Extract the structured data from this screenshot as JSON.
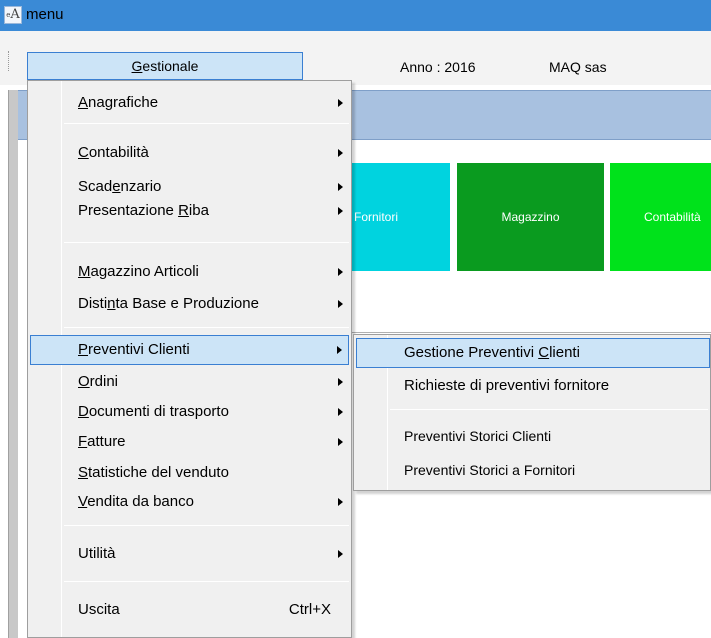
{
  "window": {
    "title": "menu",
    "icon": "app-icon"
  },
  "menubar": {
    "top_menu": {
      "prefix": "",
      "mnemonic": "G",
      "rest": "estionale"
    },
    "anno": "Anno : 2016",
    "company": "MAQ sas"
  },
  "tiles": {
    "fornitori": "Fornitori",
    "magazzino": "Magazzino",
    "contabilita": "Contabilità"
  },
  "dropdown": {
    "items": [
      {
        "pre": "",
        "mn": "A",
        "post": "nagrafiche",
        "submenu": true
      },
      {
        "pre": "",
        "mn": "C",
        "post": "ontabilità",
        "submenu": true
      },
      {
        "pre": "Scad",
        "mn": "e",
        "post": "nzario",
        "submenu": true
      },
      {
        "pre": "Presentazione ",
        "mn": "R",
        "post": "iba",
        "submenu": true
      },
      {
        "pre": "",
        "mn": "M",
        "post": "agazzino Articoli",
        "submenu": true
      },
      {
        "pre": "Disti",
        "mn": "n",
        "post": "ta Base e Produzione",
        "submenu": true
      },
      {
        "pre": "",
        "mn": "P",
        "post": "reventivi Clienti",
        "submenu": true
      },
      {
        "pre": "",
        "mn": "O",
        "post": "rdini",
        "submenu": true
      },
      {
        "pre": "",
        "mn": "D",
        "post": "ocumenti di trasporto",
        "submenu": true
      },
      {
        "pre": "",
        "mn": "F",
        "post": "atture",
        "submenu": true
      },
      {
        "pre": "",
        "mn": "S",
        "post": "tatistiche del venduto",
        "submenu": false
      },
      {
        "pre": "",
        "mn": "V",
        "post": "endita da banco",
        "submenu": true
      },
      {
        "pre": "Utilità",
        "mn": "",
        "post": "",
        "submenu": true
      },
      {
        "pre": "Uscita",
        "mn": "",
        "post": "",
        "submenu": false,
        "shortcut": "Ctrl+X"
      }
    ]
  },
  "submenu": {
    "items": [
      {
        "pre": "Gestione Preventivi ",
        "mn": "C",
        "post": "lienti"
      },
      {
        "pre": "Richieste di preventivi fornitore",
        "mn": "",
        "post": ""
      },
      {
        "pre": "Preventivi Storici Clienti",
        "mn": "",
        "post": ""
      },
      {
        "pre": "Preventivi Storici a Fornitori",
        "mn": "",
        "post": ""
      }
    ]
  }
}
